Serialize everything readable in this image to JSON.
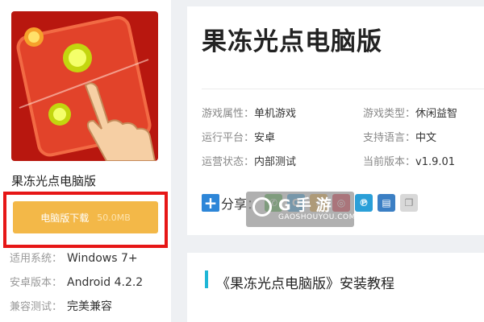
{
  "app": {
    "name": "果冻光点电脑版",
    "download_label": "电脑版下载",
    "download_size": "50.0MB"
  },
  "left_info": [
    {
      "key": "适用系统：",
      "value": "Windows 7+"
    },
    {
      "key": "安卓版本：",
      "value": "Android 4.2.2"
    },
    {
      "key": "兼容测试：",
      "value": "完美兼容"
    }
  ],
  "detail": {
    "title": "果冻光点电脑版",
    "attributes": [
      {
        "key": "游戏属性",
        "value": "单机游戏"
      },
      {
        "key": "游戏类型",
        "value": "休闲益智"
      },
      {
        "key": "运行平台",
        "value": "安卓"
      },
      {
        "key": "支持语言",
        "value": "中文"
      },
      {
        "key": "运营状态",
        "value": "内部测试"
      },
      {
        "key": "当前版本",
        "value": "v1.9.01"
      }
    ],
    "share_label": "分享："
  },
  "share_icons": [
    "wechat-icon",
    "qq-icon",
    "qzone-icon",
    "weibo-icon",
    "tencent-weibo-icon",
    "print-icon",
    "copy-icon"
  ],
  "watermark": {
    "line1": "G手游",
    "line2": "GAOSHOUYOU.COM"
  },
  "section": {
    "title": "《果冻光点电脑版》安装教程"
  },
  "colors": {
    "download": "#f3b848",
    "highlight_border": "#e61616",
    "accent": "#1fb6d6",
    "share_plus": "#2d86d8"
  }
}
